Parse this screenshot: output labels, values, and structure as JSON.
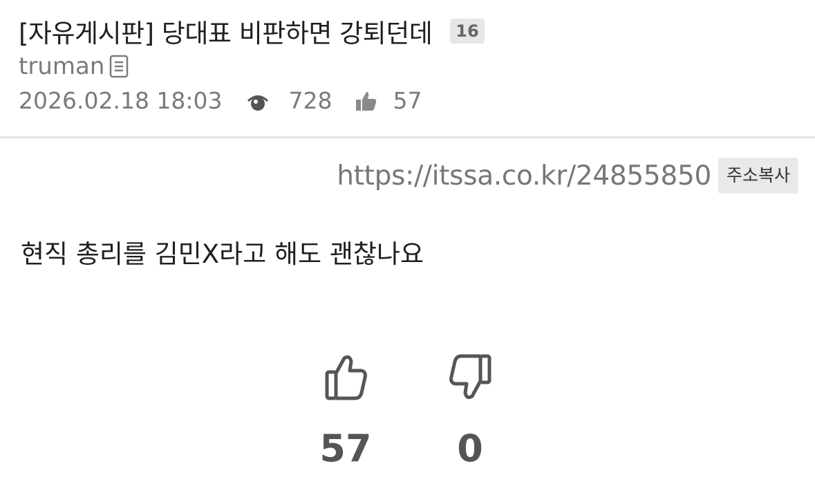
{
  "post": {
    "title": "[자유게시판] 당대표 비판하면 강퇴던데",
    "comment_count": "16",
    "author": "truman",
    "datetime": "2026.02.18 18:03",
    "views": "728",
    "likes": "57"
  },
  "share": {
    "url": "https://itssa.co.kr/24855850",
    "copy_label": "주소복사"
  },
  "content": {
    "body": "현직 총리를 김민X라고 해도 괜찮나요"
  },
  "votes": {
    "up_count": "57",
    "down_count": "0"
  },
  "icons": {
    "author_doc": "document-icon",
    "views": "eye-icon",
    "likes": "thumbs-up-icon",
    "vote_up": "thumbs-up-outline-icon",
    "vote_down": "thumbs-down-outline-icon"
  },
  "colors": {
    "meta_gray": "#7a7a7a",
    "badge_bg": "#e6e6e6",
    "divider": "#e4e4e4",
    "vote_gray": "#555555"
  }
}
